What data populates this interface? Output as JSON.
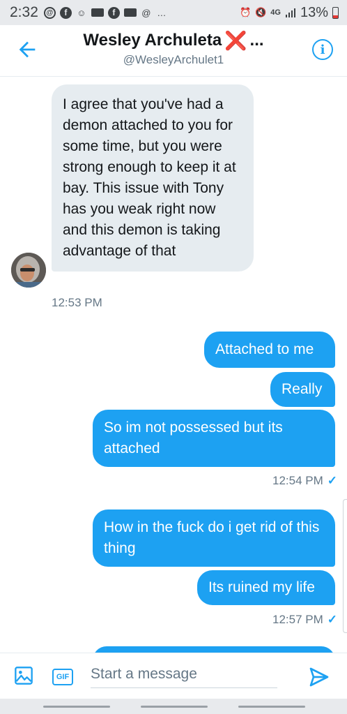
{
  "status_bar": {
    "time": "2:32",
    "network": "4G",
    "battery": "13%",
    "battery_level": 0.13,
    "more": "…"
  },
  "header": {
    "name": "Wesley Archuleta",
    "mark": "❌",
    "ellipsis": "...",
    "handle": "@WesleyArchulet1",
    "info_icon": "i",
    "accent": "#1da1f2"
  },
  "conversation": {
    "incoming": [
      {
        "text": "I agree that you've had a demon attached to you for some time, but you were strong enough to keep it at bay. This issue with Tony has you weak right now and this demon is taking advantage of that",
        "time": "12:53 PM"
      }
    ],
    "outgoing": [
      {
        "text": "Attached to me"
      },
      {
        "text": "Really"
      },
      {
        "text": "So im not possessed but its attached"
      },
      {
        "text": "How in the fuck do i get rid of this thing"
      },
      {
        "text": "Its ruined my life"
      }
    ],
    "stamps": [
      "12:54 PM",
      "12:57 PM"
    ],
    "read_mark": "✓",
    "colors": {
      "outgoing": "#1da1f2",
      "incoming": "#e6ecf0"
    }
  },
  "composer": {
    "gif_label": "GIF",
    "placeholder": "Start a message"
  }
}
